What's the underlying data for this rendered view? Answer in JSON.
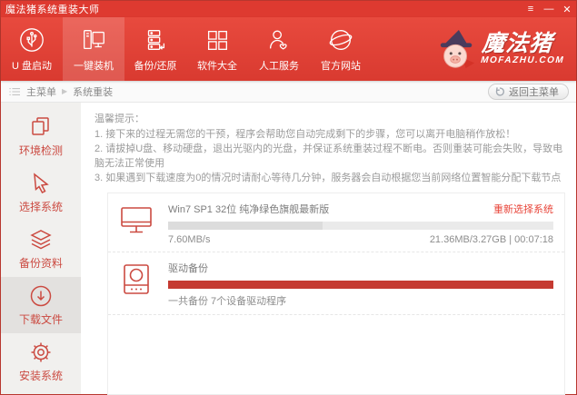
{
  "titlebar": {
    "title": "魔法猪系统重装大师",
    "controls": {
      "menu": "≡",
      "minimize": "—",
      "close": "✕"
    }
  },
  "nav": {
    "items": [
      {
        "label": "U 盘启动",
        "icon": "usb-icon"
      },
      {
        "label": "一键装机",
        "icon": "computer-icon"
      },
      {
        "label": "备份/还原",
        "icon": "backup-restore-icon"
      },
      {
        "label": "软件大全",
        "icon": "software-grid-icon"
      },
      {
        "label": "人工服务",
        "icon": "support-person-icon"
      },
      {
        "label": "官方网站",
        "icon": "globe-icon"
      }
    ],
    "active_item": "一键装机",
    "logo": {
      "brand": "魔法猪",
      "domain": "MOFAZHU.COM"
    }
  },
  "breadcrumb": {
    "root": "主菜单",
    "separator": "▶",
    "current": "系统重装",
    "back_button": "返回主菜单"
  },
  "sidebar": {
    "items": [
      {
        "label": "环境检测",
        "icon": "documents-icon",
        "active": false
      },
      {
        "label": "选择系统",
        "icon": "cursor-icon",
        "active": false
      },
      {
        "label": "备份资料",
        "icon": "layers-icon",
        "active": false
      },
      {
        "label": "下载文件",
        "icon": "download-icon",
        "active": true
      },
      {
        "label": "安装系统",
        "icon": "gear-icon",
        "active": false
      }
    ]
  },
  "main": {
    "tips": {
      "title": "温馨提示：",
      "lines": [
        "1. 接下来的过程无需您的干预，程序会帮助您自动完成剩下的步骤，您可以离开电脑稍作放松！",
        "2. 请拔掉U盘、移动硬盘，退出光驱内的光盘，并保证系统重装过程不断电。否则重装可能会失败，导致电脑无法正常使用",
        "3. 如果遇到下载速度为0的情况时请耐心等待几分钟，服务器会自动根据您当前网络位置智能分配下载节点"
      ]
    },
    "downloads": [
      {
        "icon": "monitor-icon",
        "title": "Win7 SP1 32位 纯净绿色旗舰最新版",
        "action_label": "重新选择系统",
        "speed": "7.60MB/s",
        "stats": "21.36MB/3.27GB | 00:07:18",
        "progress_width": "40%",
        "progress_color": "#dcdcdc"
      },
      {
        "icon": "drive-icon",
        "title": "驱动备份",
        "summary": "一共备份 7个设备驱动程序",
        "progress_width": "100%",
        "progress_color": "#c53a31"
      }
    ]
  },
  "colors": {
    "header_red": "#d93a30",
    "active_tab_overlay": "rgba(255,255,255,0.16)",
    "sidebar_accent": "#cb4a41",
    "progress_red": "#c53a31",
    "link_red": "#e8453a"
  }
}
